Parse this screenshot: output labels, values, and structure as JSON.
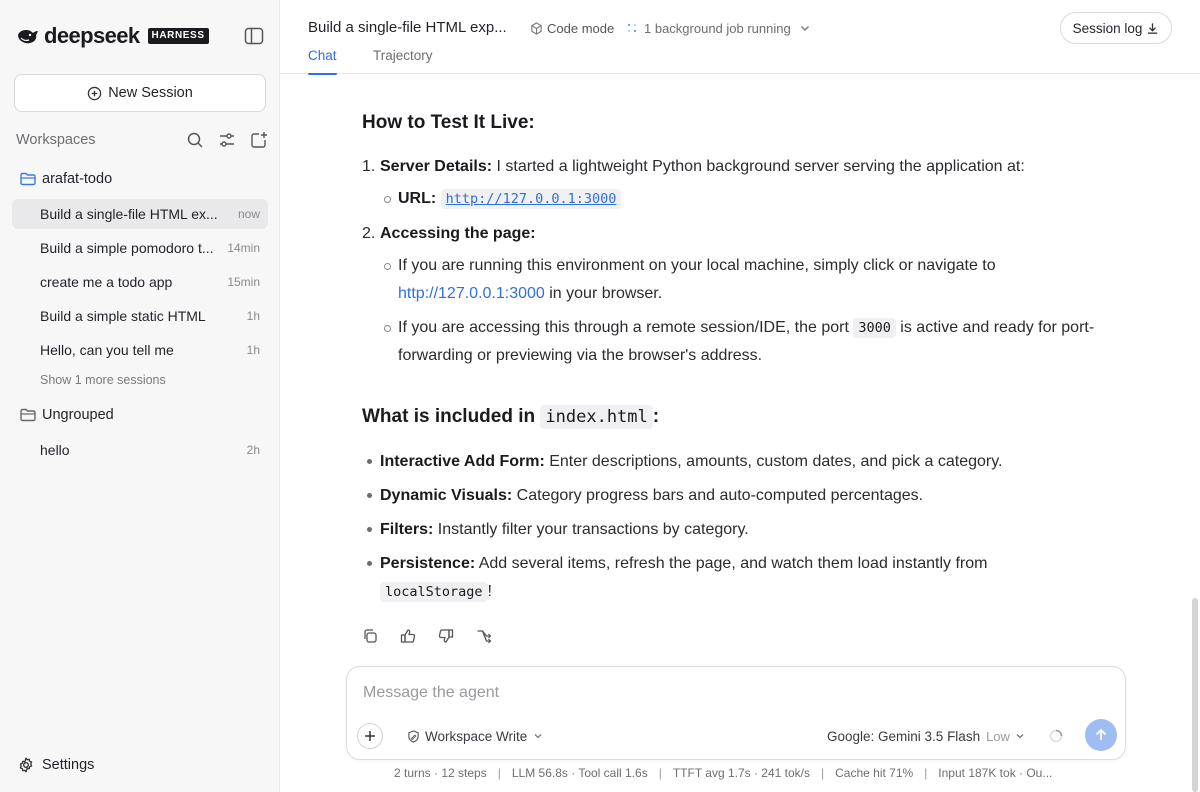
{
  "brand": {
    "name": "deepseek",
    "tag": "HARNESS"
  },
  "sidebar": {
    "new_session_label": "New Session",
    "workspaces_label": "Workspaces",
    "groups": [
      {
        "name": "arafat-todo",
        "sessions": [
          {
            "title": "Build a single-file HTML ex...",
            "time": "now"
          },
          {
            "title": "Build a simple pomodoro t...",
            "time": "14min"
          },
          {
            "title": "create me a todo app",
            "time": "15min"
          },
          {
            "title": "Build a simple static HTML",
            "time": "1h"
          },
          {
            "title": "Hello, can you tell me",
            "time": "1h"
          }
        ],
        "show_more": "Show 1 more sessions"
      },
      {
        "name": "Ungrouped",
        "sessions": [
          {
            "title": "hello",
            "time": "2h"
          }
        ]
      }
    ],
    "settings_label": "Settings"
  },
  "header": {
    "title": "Build a single-file HTML exp...",
    "mode": "Code mode",
    "background_jobs": "1 background job running",
    "session_log_label": "Session log",
    "tabs": [
      {
        "label": "Chat"
      },
      {
        "label": "Trajectory"
      }
    ]
  },
  "message": {
    "test_heading": "How to Test It Live:",
    "steps": [
      {
        "num": "1.",
        "bold": "Server Details:",
        "text": " I started a lightweight Python background server serving the application at:",
        "sub": {
          "bold": "URL:",
          "code": "http://127.0.0.1:3000"
        }
      },
      {
        "num": "2.",
        "bold": "Accessing the page:",
        "subs": [
          {
            "line1": "If you are running this environment on your local machine, simply click or navigate to",
            "link": "http://127.0.0.1:3000",
            "line2": " in your browser."
          },
          {
            "pre": "If you are accessing this through a remote session/IDE, the port ",
            "code": "3000",
            "post": " is active and ready for port-",
            "line2": "forwarding or previewing via the browser's address."
          }
        ]
      }
    ],
    "included_heading_pre": "What is included in ",
    "included_heading_code": "index.html",
    "included_heading_post": ":",
    "bullets": [
      {
        "bold": "Interactive Add Form:",
        "text": " Enter descriptions, amounts, custom dates, and pick a category."
      },
      {
        "bold": "Dynamic Visuals:",
        "text": " Category progress bars and auto-computed percentages."
      },
      {
        "bold": "Filters:",
        "text": " Instantly filter your transactions by category."
      },
      {
        "bold": "Persistence:",
        "text": " Add several items, refresh the page, and watch them load instantly from",
        "code": "localStorage",
        "after": "!"
      }
    ]
  },
  "composer": {
    "placeholder": "Message the agent",
    "permission": "Workspace Write",
    "model": "Google: Gemini 3.5 Flash",
    "effort": "Low"
  },
  "status": {
    "items": [
      "2 turns · 12 steps",
      "LLM 56.8s · Tool call 1.6s",
      "TTFT avg 1.7s · 241 tok/s",
      "Cache hit 71%",
      "Input 187K tok · Ou..."
    ]
  },
  "colors": {
    "accent": "#2f6fde",
    "send_button": "#9fbdf2",
    "sidebar_bg": "#f7f7f8",
    "folder_icon": "#3b78e7"
  }
}
